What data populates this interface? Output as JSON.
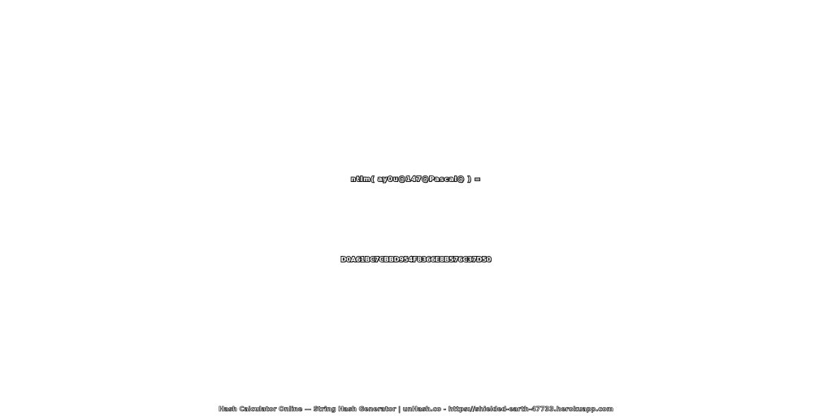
{
  "expression": "ntlm( ay0u@147@Pascal@ ) =",
  "hash": "D0A61BC7CBBD954F8366E8B576C37D50",
  "footer": "Hash Calculator Online — String Hash Generator | unHash.co - https://shielded-earth-47733.herokuapp.com"
}
